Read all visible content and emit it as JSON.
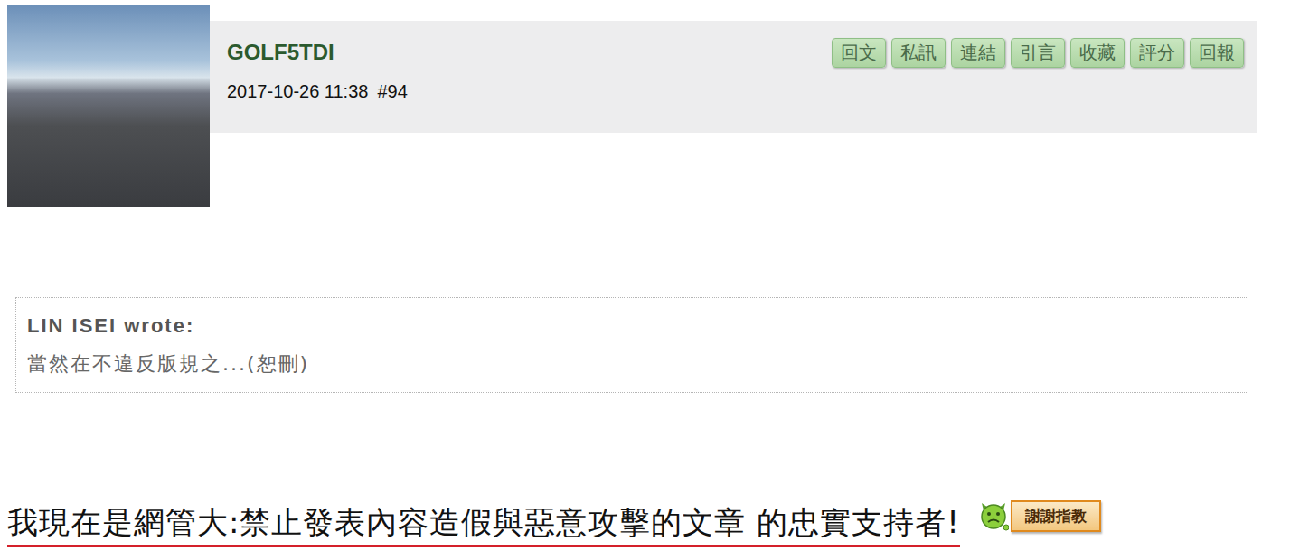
{
  "post": {
    "author": "GOLF5TDI",
    "time": "2017-10-26 11:38",
    "number": "#94",
    "actions": [
      "回文",
      "私訊",
      "連結",
      "引言",
      "收藏",
      "評分",
      "回報"
    ]
  },
  "quote": {
    "author": "LIN ISEI wrote:",
    "text": "當然在不違反版規之...(恕刪)"
  },
  "signature": {
    "text": "我現在是網管大:禁止發表內容造假與惡意攻擊的文章 的忠實支持者!",
    "badge": "謝謝指教"
  }
}
